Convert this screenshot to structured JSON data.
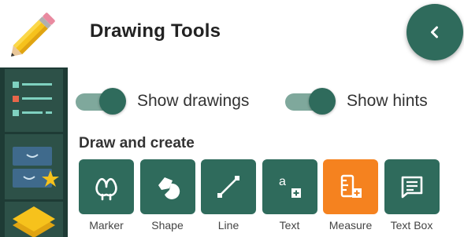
{
  "panel": {
    "title": "Drawing Tools",
    "collapse_icon": "chevron-left-icon"
  },
  "toggles": [
    {
      "label": "Show drawings",
      "on": true
    },
    {
      "label": "Show hints",
      "on": true
    }
  ],
  "section": {
    "title": "Draw and create"
  },
  "tools": [
    {
      "label": "Marker",
      "icon": "marker-icon",
      "active": false
    },
    {
      "label": "Shape",
      "icon": "shape-icon",
      "active": false
    },
    {
      "label": "Line",
      "icon": "line-icon",
      "active": false
    },
    {
      "label": "Text",
      "icon": "text-icon",
      "active": false
    },
    {
      "label": "Measure",
      "icon": "measure-icon",
      "active": true
    },
    {
      "label": "Text Box",
      "icon": "text-box-icon",
      "active": false
    }
  ],
  "rail": {
    "items": [
      "pencil-icon",
      "list-icon",
      "drawer-star-icon",
      "layers-icon"
    ]
  },
  "colors": {
    "accent": "#2f6b5c",
    "active": "#f5821f",
    "rail": "#1e3b35"
  }
}
